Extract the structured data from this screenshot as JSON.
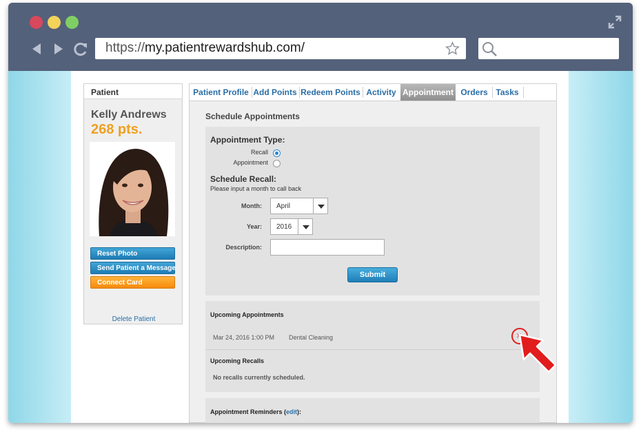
{
  "browser": {
    "url_scheme": "https://",
    "url_host": "my.patientrewardshub.com/",
    "search_placeholder": ""
  },
  "patient_panel": {
    "header": "Patient",
    "name": "Kelly Andrews",
    "points": "268 pts.",
    "buttons": {
      "reset_photo": "Reset Photo",
      "send_message": "Send Patient a Message",
      "connect_card": "Connect Card"
    },
    "delete_link": "Delete Patient"
  },
  "tabs": [
    {
      "label": "Patient Profile"
    },
    {
      "label": "Add Points"
    },
    {
      "label": "Redeem Points"
    },
    {
      "label": "Activity"
    },
    {
      "label": "Appointment",
      "active": true
    },
    {
      "label": "Orders"
    },
    {
      "label": "Tasks"
    }
  ],
  "schedule": {
    "title": "Schedule Appointments",
    "appointment_type_label": "Appointment Type:",
    "options": {
      "recall": "Recall",
      "appointment": "Appointment",
      "selected": "Recall"
    },
    "recall_heading": "Schedule Recall:",
    "recall_hint": "Please input a month to call back",
    "month_label": "Month:",
    "month_value": "April",
    "year_label": "Year:",
    "year_value": "2016",
    "description_label": "Description:",
    "description_value": "",
    "submit_label": "Submit"
  },
  "upcoming": {
    "appointments_heading": "Upcoming Appointments",
    "appointment_date": "Mar 24, 2016 1:00 PM",
    "appointment_type": "Dental Cleaning",
    "cancel_glyph": "×",
    "recalls_heading": "Upcoming Recalls",
    "recalls_empty": "No recalls currently scheduled."
  },
  "reminders": {
    "label": "Appointment Reminders (",
    "edit_link": "edit",
    "suffix": "):"
  },
  "colors": {
    "chrome": "#54617b",
    "points": "#f0a020",
    "link": "#2a6ea6",
    "highlight_red": "#e11d1d"
  },
  "icons": [
    "back-icon",
    "forward-icon",
    "reload-icon",
    "star-icon",
    "search-icon",
    "expand-icon",
    "remove-icon",
    "pointer-arrow-icon"
  ]
}
